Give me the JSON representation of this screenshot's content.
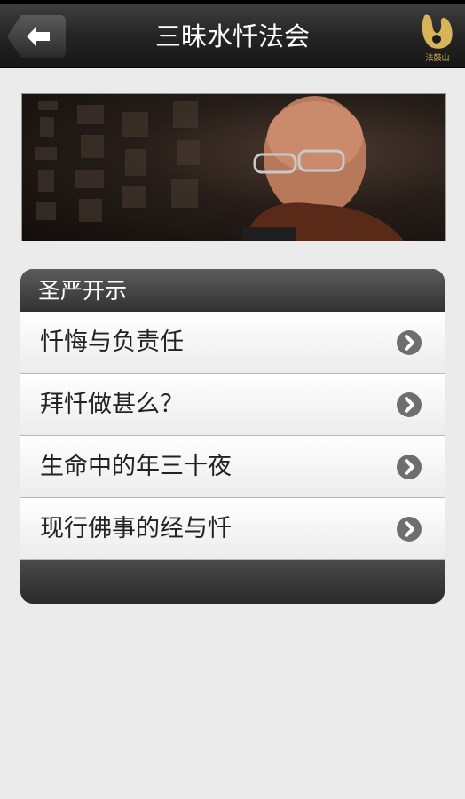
{
  "header": {
    "title": "三昧水忏法会",
    "back_icon": "arrow-left-icon",
    "logo_text": "法鼓山"
  },
  "banner": {
    "image": "photo of monk"
  },
  "section": {
    "title": "圣严开示",
    "items": [
      {
        "label": "忏悔与负责任",
        "icon": "chevron-right-icon"
      },
      {
        "label": "拜忏做甚么？",
        "icon": "chevron-right-icon"
      },
      {
        "label": "生命中的年三十夜",
        "icon": "chevron-right-icon"
      },
      {
        "label": "现行佛事的经与忏",
        "icon": "chevron-right-icon"
      }
    ]
  },
  "colors": {
    "topbar": "#252525",
    "background": "#ebebeb",
    "logo": "#d9b35a"
  }
}
